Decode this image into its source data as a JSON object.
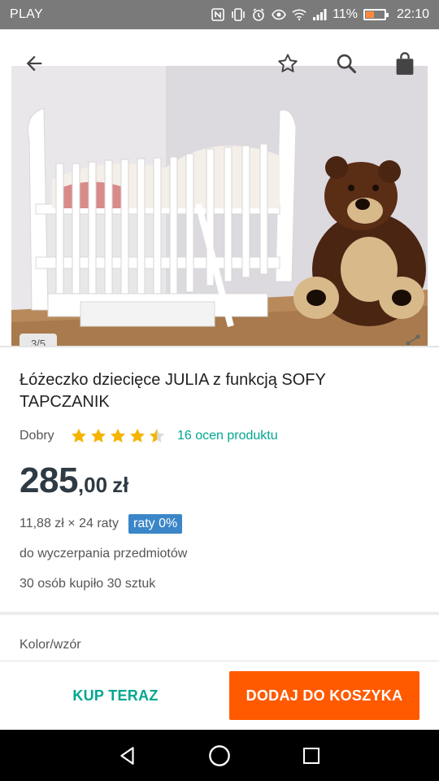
{
  "status_bar": {
    "carrier": "PLAY",
    "battery_percent": "11%",
    "time": "22:10",
    "icons": [
      "nfc-icon",
      "vibrate-icon",
      "alarm-icon",
      "eye-icon",
      "wifi-icon",
      "signal-icon",
      "battery-icon"
    ],
    "battery_color": "#ff8a3d"
  },
  "toolbar": {
    "icons": [
      "back-arrow-icon",
      "favorite-star-icon",
      "search-icon",
      "shopping-bag-icon"
    ]
  },
  "gallery": {
    "pager": "3/5",
    "icons": [
      "share-icon"
    ]
  },
  "product": {
    "title": "Łóżeczko dziecięce JULIA z funkcją SOFY TAPCZANIK",
    "rating_label": "Dobry",
    "rating_value": 4.5,
    "rating_max": 5,
    "reviews_link": "16 ocen produktu",
    "price_main": "285",
    "price_decimal": ",00",
    "price_currency": "zł",
    "installments_text": "11,88 zł × 24 raty",
    "installments_badge": "raty 0%",
    "availability": "do wyczerpania przedmiotów",
    "sold": "30 osób kupiło 30 sztuk",
    "variant_label": "Kolor/wzór"
  },
  "actions": {
    "buy_now": "KUP TERAZ",
    "add_to_cart": "DODAJ DO KOSZYKA",
    "accent_color": "#ff5a00",
    "link_color": "#00a790"
  },
  "nav_bar": {
    "icons": [
      "back-triangle-icon",
      "home-circle-icon",
      "recents-square-icon"
    ]
  }
}
